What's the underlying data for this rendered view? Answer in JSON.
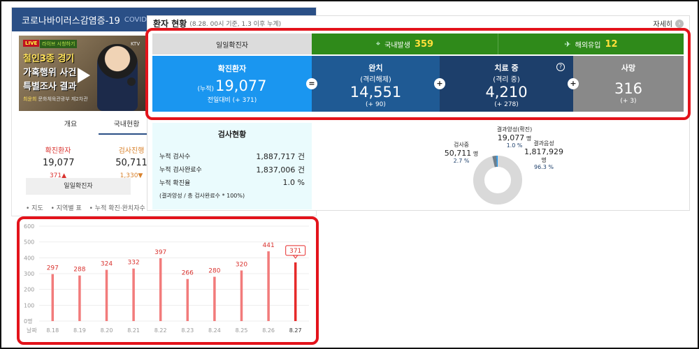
{
  "left_panel": {
    "header_title": "코로나바이러스감염증-19",
    "header_sub": "COVID-",
    "video": {
      "live_tag": "LIVE",
      "live_sub": "라이브 시청하기",
      "caption_lines": [
        "철인3종 경기",
        "가혹행위 사건",
        "특별조사 결과"
      ],
      "byline_name": "최윤희",
      "byline_role": "문화체육관광부 제2차관",
      "channel": "KTV"
    },
    "tabs": [
      "개요",
      "국내현황"
    ],
    "active_tab": "국내현황",
    "stats": [
      {
        "label": "확진환자",
        "value": "19,077",
        "change": "371▲"
      },
      {
        "label": "검사진행",
        "value": "50,711",
        "change": "1,330▼"
      }
    ],
    "daily_tab_label": "일일확진자",
    "links": [
      "• 지도",
      "• 지역별 표",
      "• 누적 확진·완치자수"
    ]
  },
  "main": {
    "title": "환자 현황",
    "subtitle": "(8.28. 00시 기준, 1.3 이후 누계)",
    "more_label": "자세히",
    "daily_label": "일일확진자",
    "domestic": {
      "label": "국내발생",
      "value": "359"
    },
    "imported": {
      "label": "해외유입",
      "value": "12"
    },
    "confirmed": {
      "title": "확진환자",
      "prefix": "(누적)",
      "value": "19,077",
      "change": "전일대비 (+ 371)"
    },
    "released": {
      "title": "완치",
      "subtitle": "(격리해제)",
      "value": "14,551",
      "change": "(+ 90)"
    },
    "treatment": {
      "title": "치료 중",
      "subtitle": "(격리 중)",
      "value": "4,210",
      "change": "(+ 278)"
    },
    "deceased": {
      "title": "사망",
      "value": "316",
      "change": "(+ 3)"
    },
    "operators": [
      "=",
      "+",
      "+",
      "+"
    ],
    "question_mark": "?"
  },
  "tests": {
    "title": "검사현황",
    "rows": [
      {
        "label": "누적 검사수",
        "value": "1,887,717 건"
      },
      {
        "label": "누적 검사완료수",
        "value": "1,837,006 건"
      },
      {
        "label": "누적 확진율",
        "value": "1.0 %"
      }
    ],
    "note": "(결과양성 / 총 검사완료수 * 100%)"
  },
  "donut": {
    "positive": {
      "label": "결과양성(확진)",
      "value": "19,077",
      "unit": "명",
      "pct": "1.0 %",
      "share": 1.0
    },
    "testing": {
      "label": "검사중",
      "value": "50,711",
      "unit": "명",
      "pct": "2.7 %",
      "share": 2.7
    },
    "negative": {
      "label": "결과음성",
      "value": "1,817,929",
      "unit": "명",
      "pct": "96.3 %",
      "share": 96.3
    },
    "colors": {
      "positive": "#1a96f0",
      "testing": "#6f7e8a",
      "negative": "#d9d9d9"
    }
  },
  "chart_data": {
    "type": "bar",
    "categories": [
      "8.18",
      "8.19",
      "8.20",
      "8.21",
      "8.22",
      "8.23",
      "8.24",
      "8.25",
      "8.26",
      "8.27"
    ],
    "values": [
      297,
      288,
      324,
      332,
      397,
      266,
      280,
      320,
      441,
      371
    ],
    "ylim": [
      0,
      600
    ],
    "yticks": [
      "0명",
      "100",
      "200",
      "300",
      "400",
      "500",
      "600"
    ],
    "x_axis_label": "날짜",
    "highlight_index": 9,
    "colors": {
      "bar": "#f27b7b",
      "highlight": "#e62a2a",
      "label": "#d9322e",
      "grid": "#ededed"
    }
  }
}
